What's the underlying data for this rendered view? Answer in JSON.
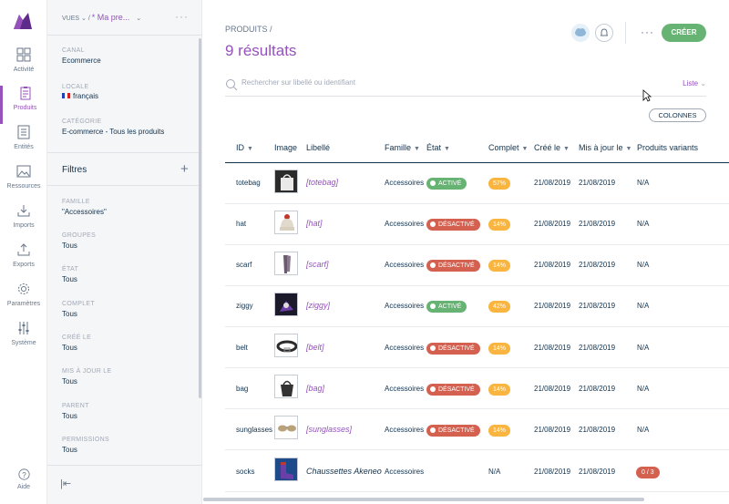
{
  "rail": {
    "items": [
      {
        "label": "Activité",
        "icon": "dashboard-icon"
      },
      {
        "label": "Produits",
        "icon": "clipboard-icon",
        "active": true
      },
      {
        "label": "Entités",
        "icon": "entities-icon"
      },
      {
        "label": "Ressources",
        "icon": "image-icon"
      },
      {
        "label": "Imports",
        "icon": "import-icon"
      },
      {
        "label": "Exports",
        "icon": "export-icon"
      },
      {
        "label": "Paramètres",
        "icon": "gear-icon"
      },
      {
        "label": "Système",
        "icon": "sliders-icon"
      }
    ],
    "help": "Aide"
  },
  "filters": {
    "views_label": "VUES",
    "view_name": "* Ma pre...",
    "channel_label": "CANAL",
    "channel_value": "Ecommerce",
    "locale_label": "LOCALE",
    "locale_value": "français",
    "category_label": "CATÉGORIE",
    "category_value": "E-commerce - Tous les produits",
    "title": "Filtres",
    "items": [
      {
        "label": "FAMILLE",
        "value": "\"Accessoires\""
      },
      {
        "label": "GROUPES",
        "value": "Tous"
      },
      {
        "label": "ÉTAT",
        "value": "Tous"
      },
      {
        "label": "COMPLET",
        "value": "Tous"
      },
      {
        "label": "CRÉÉ LE",
        "value": "Tous"
      },
      {
        "label": "MIS À JOUR LE",
        "value": "Tous"
      },
      {
        "label": "PARENT",
        "value": "Tous"
      },
      {
        "label": "PERMISSIONS",
        "value": "Tous"
      }
    ]
  },
  "main": {
    "breadcrumb": "PRODUITS /",
    "results": "9 résultats",
    "create_label": "CRÉER",
    "search_placeholder": "Rechercher sur libellé ou identifiant",
    "display_mode": "Liste",
    "columns_label": "COLONNES",
    "headers": [
      "ID",
      "Image",
      "Libellé",
      "Famille",
      "État",
      "Complet",
      "Créé le",
      "Mis à jour le",
      "Produits variants"
    ]
  },
  "products": [
    {
      "id": "totebag",
      "label": "[totebag]",
      "family": "Accessoires",
      "status": "ACTIVÉ",
      "active": true,
      "complete": "57%",
      "created": "21/08/2019",
      "updated": "21/08/2019",
      "variants": "N/A"
    },
    {
      "id": "hat",
      "label": "[hat]",
      "family": "Accessoires",
      "status": "DÉSACTIVÉ",
      "active": false,
      "complete": "14%",
      "created": "21/08/2019",
      "updated": "21/08/2019",
      "variants": "N/A"
    },
    {
      "id": "scarf",
      "label": "[scarf]",
      "family": "Accessoires",
      "status": "DÉSACTIVÉ",
      "active": false,
      "complete": "14%",
      "created": "21/08/2019",
      "updated": "21/08/2019",
      "variants": "N/A"
    },
    {
      "id": "ziggy",
      "label": "[ziggy]",
      "family": "Accessoires",
      "status": "ACTIVÉ",
      "active": true,
      "complete": "42%",
      "created": "21/08/2019",
      "updated": "21/08/2019",
      "variants": "N/A"
    },
    {
      "id": "belt",
      "label": "[belt]",
      "family": "Accessoires",
      "status": "DÉSACTIVÉ",
      "active": false,
      "complete": "14%",
      "created": "21/08/2019",
      "updated": "21/08/2019",
      "variants": "N/A"
    },
    {
      "id": "bag",
      "label": "[bag]",
      "family": "Accessoires",
      "status": "DÉSACTIVÉ",
      "active": false,
      "complete": "14%",
      "created": "21/08/2019",
      "updated": "21/08/2019",
      "variants": "N/A"
    },
    {
      "id": "sunglasses",
      "label": "[sunglasses]",
      "family": "Accessoires",
      "status": "DÉSACTIVÉ",
      "active": false,
      "complete": "14%",
      "created": "21/08/2019",
      "updated": "21/08/2019",
      "variants": "N/A"
    },
    {
      "id": "socks",
      "label": "Chaussettes Akeneo",
      "family": "Accessoires",
      "status": "",
      "active": null,
      "complete": "N/A",
      "created": "21/08/2019",
      "updated": "21/08/2019",
      "variants": "0 / 3"
    }
  ],
  "colors": {
    "accent": "#9452ba",
    "active": "#67b373",
    "inactive": "#d4604f",
    "warning": "#f9b53f"
  }
}
